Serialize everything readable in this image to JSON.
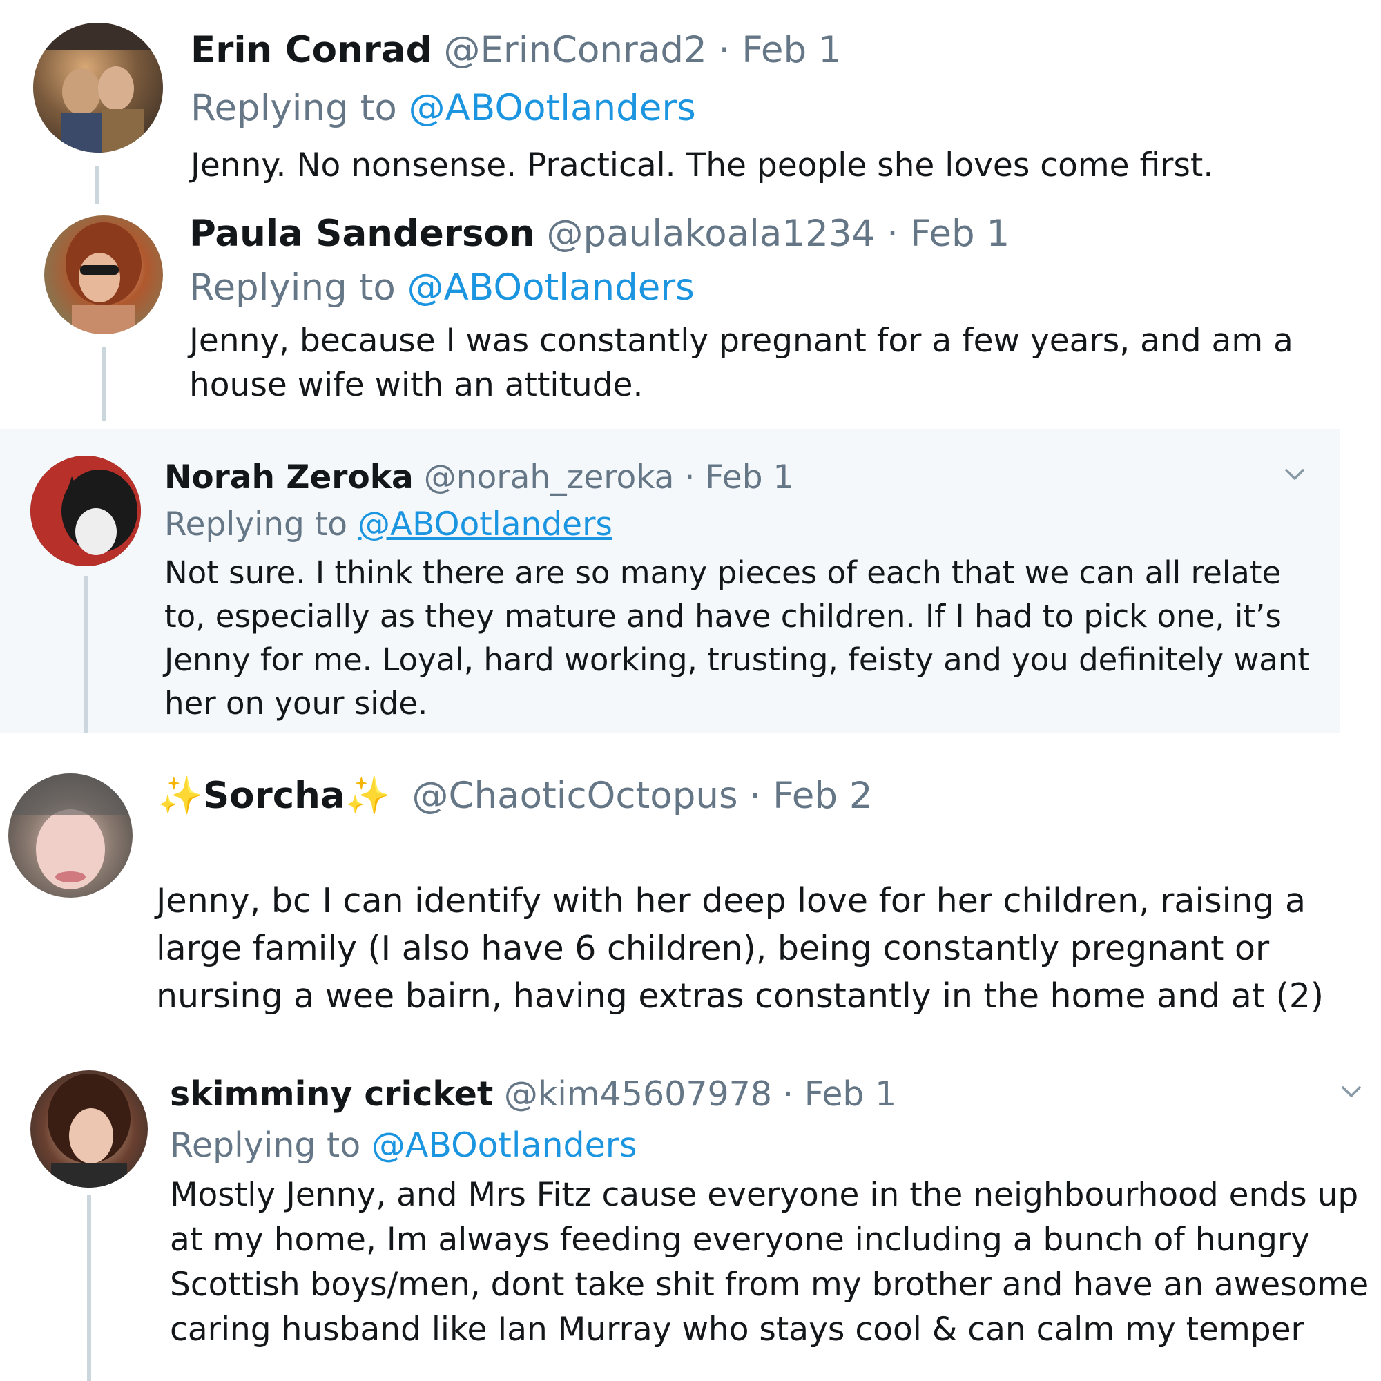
{
  "tweets": [
    {
      "name": "Erin Conrad",
      "handle": "@ErinConrad2",
      "sep": "·",
      "date": "Feb 1",
      "replying_prefix": "Replying to",
      "replying_to": "@ABOotlanders",
      "text": "Jenny. No nonsense. Practical. The people she loves come first."
    },
    {
      "name": "Paula Sanderson",
      "handle": "@paulakoala1234",
      "sep": "·",
      "date": "Feb 1",
      "replying_prefix": "Replying to",
      "replying_to": "@ABOotlanders",
      "text": "Jenny, because I was constantly pregnant for a few years, and am a house wife with an attitude."
    },
    {
      "name": "Norah Zeroka",
      "handle": "@norah_zeroka",
      "sep": "·",
      "date": "Feb 1",
      "replying_prefix": "Replying to",
      "replying_to": "@ABOotlanders",
      "text": "Not sure. I think there are so many pieces of each that we can all relate to, especially as they mature and have children. If I had to pick one, it’s Jenny for me. Loyal, hard working, trusting, feisty and you definitely want her on your side."
    },
    {
      "name": "Sorcha",
      "name_emoji": "✨",
      "handle": "@ChaoticOctopus",
      "sep": "·",
      "date": "Feb 2",
      "text": "Jenny, bc I can identify with her deep love for her children, raising a large family (I also have 6 children), being constantly pregnant or nursing a wee bairn, having extras constantly in the home and at (2)"
    },
    {
      "name": "skimminy cricket",
      "handle": "@kim45607978",
      "sep": "·",
      "date": "Feb 1",
      "replying_prefix": "Replying to",
      "replying_to": "@ABOotlanders",
      "text": "Mostly Jenny, and Mrs Fitz cause everyone in the neighbourhood ends up at my home, Im always feeding everyone including a bunch of hungry Scottish boys/men, dont take shit from my brother and have an awesome caring husband like Ian Murray who stays cool & can calm my temper"
    }
  ],
  "colors": {
    "text": "#14171a",
    "meta": "#657786",
    "link": "#1b95e0",
    "thread_line": "#ccd6dd",
    "highlight_bg": "#f5f8fa"
  },
  "icons": [
    "chevron-down-icon",
    "sparkles-icon"
  ]
}
